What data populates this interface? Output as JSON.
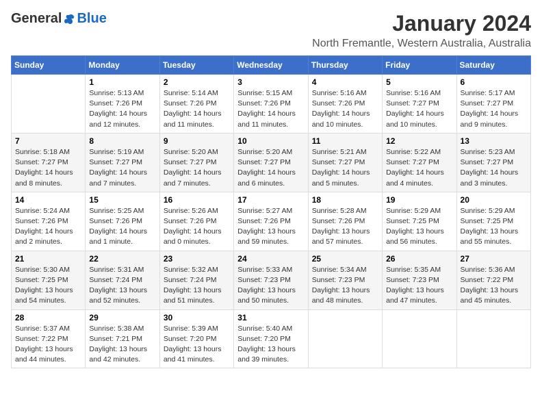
{
  "header": {
    "logo_general": "General",
    "logo_blue": "Blue",
    "month_title": "January 2024",
    "location": "North Fremantle, Western Australia, Australia"
  },
  "days_of_week": [
    "Sunday",
    "Monday",
    "Tuesday",
    "Wednesday",
    "Thursday",
    "Friday",
    "Saturday"
  ],
  "weeks": [
    [
      {
        "day": "",
        "info": ""
      },
      {
        "day": "1",
        "info": "Sunrise: 5:13 AM\nSunset: 7:26 PM\nDaylight: 14 hours\nand 12 minutes."
      },
      {
        "day": "2",
        "info": "Sunrise: 5:14 AM\nSunset: 7:26 PM\nDaylight: 14 hours\nand 11 minutes."
      },
      {
        "day": "3",
        "info": "Sunrise: 5:15 AM\nSunset: 7:26 PM\nDaylight: 14 hours\nand 11 minutes."
      },
      {
        "day": "4",
        "info": "Sunrise: 5:16 AM\nSunset: 7:26 PM\nDaylight: 14 hours\nand 10 minutes."
      },
      {
        "day": "5",
        "info": "Sunrise: 5:16 AM\nSunset: 7:27 PM\nDaylight: 14 hours\nand 10 minutes."
      },
      {
        "day": "6",
        "info": "Sunrise: 5:17 AM\nSunset: 7:27 PM\nDaylight: 14 hours\nand 9 minutes."
      }
    ],
    [
      {
        "day": "7",
        "info": "Sunrise: 5:18 AM\nSunset: 7:27 PM\nDaylight: 14 hours\nand 8 minutes."
      },
      {
        "day": "8",
        "info": "Sunrise: 5:19 AM\nSunset: 7:27 PM\nDaylight: 14 hours\nand 7 minutes."
      },
      {
        "day": "9",
        "info": "Sunrise: 5:20 AM\nSunset: 7:27 PM\nDaylight: 14 hours\nand 7 minutes."
      },
      {
        "day": "10",
        "info": "Sunrise: 5:20 AM\nSunset: 7:27 PM\nDaylight: 14 hours\nand 6 minutes."
      },
      {
        "day": "11",
        "info": "Sunrise: 5:21 AM\nSunset: 7:27 PM\nDaylight: 14 hours\nand 5 minutes."
      },
      {
        "day": "12",
        "info": "Sunrise: 5:22 AM\nSunset: 7:27 PM\nDaylight: 14 hours\nand 4 minutes."
      },
      {
        "day": "13",
        "info": "Sunrise: 5:23 AM\nSunset: 7:27 PM\nDaylight: 14 hours\nand 3 minutes."
      }
    ],
    [
      {
        "day": "14",
        "info": "Sunrise: 5:24 AM\nSunset: 7:26 PM\nDaylight: 14 hours\nand 2 minutes."
      },
      {
        "day": "15",
        "info": "Sunrise: 5:25 AM\nSunset: 7:26 PM\nDaylight: 14 hours\nand 1 minute."
      },
      {
        "day": "16",
        "info": "Sunrise: 5:26 AM\nSunset: 7:26 PM\nDaylight: 14 hours\nand 0 minutes."
      },
      {
        "day": "17",
        "info": "Sunrise: 5:27 AM\nSunset: 7:26 PM\nDaylight: 13 hours\nand 59 minutes."
      },
      {
        "day": "18",
        "info": "Sunrise: 5:28 AM\nSunset: 7:26 PM\nDaylight: 13 hours\nand 57 minutes."
      },
      {
        "day": "19",
        "info": "Sunrise: 5:29 AM\nSunset: 7:25 PM\nDaylight: 13 hours\nand 56 minutes."
      },
      {
        "day": "20",
        "info": "Sunrise: 5:29 AM\nSunset: 7:25 PM\nDaylight: 13 hours\nand 55 minutes."
      }
    ],
    [
      {
        "day": "21",
        "info": "Sunrise: 5:30 AM\nSunset: 7:25 PM\nDaylight: 13 hours\nand 54 minutes."
      },
      {
        "day": "22",
        "info": "Sunrise: 5:31 AM\nSunset: 7:24 PM\nDaylight: 13 hours\nand 52 minutes."
      },
      {
        "day": "23",
        "info": "Sunrise: 5:32 AM\nSunset: 7:24 PM\nDaylight: 13 hours\nand 51 minutes."
      },
      {
        "day": "24",
        "info": "Sunrise: 5:33 AM\nSunset: 7:23 PM\nDaylight: 13 hours\nand 50 minutes."
      },
      {
        "day": "25",
        "info": "Sunrise: 5:34 AM\nSunset: 7:23 PM\nDaylight: 13 hours\nand 48 minutes."
      },
      {
        "day": "26",
        "info": "Sunrise: 5:35 AM\nSunset: 7:23 PM\nDaylight: 13 hours\nand 47 minutes."
      },
      {
        "day": "27",
        "info": "Sunrise: 5:36 AM\nSunset: 7:22 PM\nDaylight: 13 hours\nand 45 minutes."
      }
    ],
    [
      {
        "day": "28",
        "info": "Sunrise: 5:37 AM\nSunset: 7:22 PM\nDaylight: 13 hours\nand 44 minutes."
      },
      {
        "day": "29",
        "info": "Sunrise: 5:38 AM\nSunset: 7:21 PM\nDaylight: 13 hours\nand 42 minutes."
      },
      {
        "day": "30",
        "info": "Sunrise: 5:39 AM\nSunset: 7:20 PM\nDaylight: 13 hours\nand 41 minutes."
      },
      {
        "day": "31",
        "info": "Sunrise: 5:40 AM\nSunset: 7:20 PM\nDaylight: 13 hours\nand 39 minutes."
      },
      {
        "day": "",
        "info": ""
      },
      {
        "day": "",
        "info": ""
      },
      {
        "day": "",
        "info": ""
      }
    ]
  ]
}
